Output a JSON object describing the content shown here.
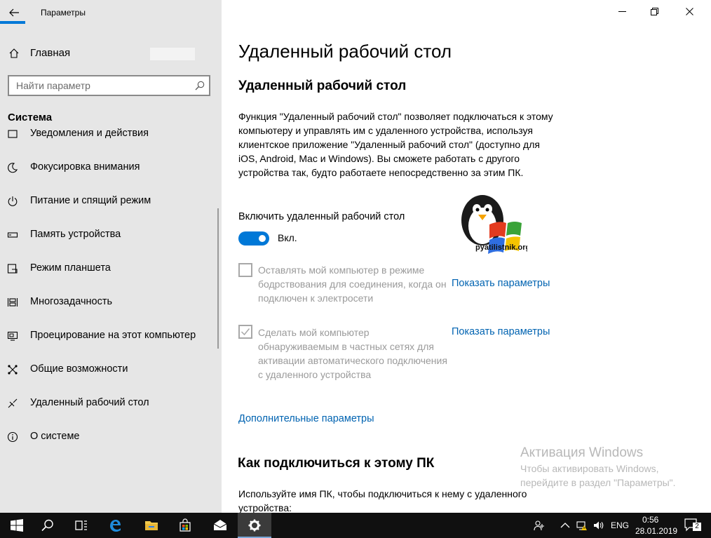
{
  "app": {
    "title": "Параметры"
  },
  "sidebar": {
    "home_label": "Главная",
    "search_placeholder": "Найти параметр",
    "section_title": "Система",
    "items": [
      {
        "label": "Уведомления и действия",
        "icon": "notifications-icon"
      },
      {
        "label": "Фокусировка внимания",
        "icon": "moon-icon"
      },
      {
        "label": "Питание и спящий режим",
        "icon": "power-icon"
      },
      {
        "label": "Память устройства",
        "icon": "storage-icon"
      },
      {
        "label": "Режим планшета",
        "icon": "tablet-icon"
      },
      {
        "label": "Многозадачность",
        "icon": "multitasking-icon"
      },
      {
        "label": "Проецирование на этот компьютер",
        "icon": "projecting-icon"
      },
      {
        "label": "Общие возможности",
        "icon": "shared-experiences-icon"
      },
      {
        "label": "Удаленный рабочий стол",
        "icon": "remote-desktop-icon"
      },
      {
        "label": "О системе",
        "icon": "info-icon"
      }
    ]
  },
  "main": {
    "page_title": "Удаленный рабочий стол",
    "sub_title": "Удаленный рабочий стол",
    "description": "Функция \"Удаленный рабочий стол\" позволяет подключаться к этому компьютеру и управлять им с удаленного устройства, используя клиентское приложение \"Удаленный рабочий стол\" (доступно для iOS, Android, Mac и Windows). Вы сможете работать с другого устройства так, будто работаете непосредственно за этим ПК.",
    "toggle_label": "Включить удаленный рабочий стол",
    "toggle_state": "Вкл.",
    "toggle_on": true,
    "option1": {
      "text": "Оставлять мой компьютер в режиме бодрствования для соединения, когда он подключен к электросети",
      "checked": false,
      "link": "Показать параметры"
    },
    "option2": {
      "text": "Сделать мой компьютер обнаруживаемым в частных сетях для активации автоматического подключения с удаленного устройства",
      "checked": true,
      "link": "Показать параметры"
    },
    "advanced_link": "Дополнительные параметры",
    "section2_title": "Как подключиться к этому ПК",
    "section2_desc": "Используйте имя ПК, чтобы подключиться к нему с удаленного устройства:",
    "logo_text": "pyatilistnik.org"
  },
  "watermark": {
    "title": "Активация Windows",
    "text": "Чтобы активировать Windows, перейдите в раздел \"Параметры\"."
  },
  "taskbar": {
    "language": "ENG",
    "time": "0:56",
    "date": "28.01.2019",
    "notifications_count": "2"
  },
  "colors": {
    "accent": "#0078d7",
    "link": "#0063b1",
    "sidebar_bg": "#e6e6e6",
    "taskbar_bg": "#101010"
  }
}
